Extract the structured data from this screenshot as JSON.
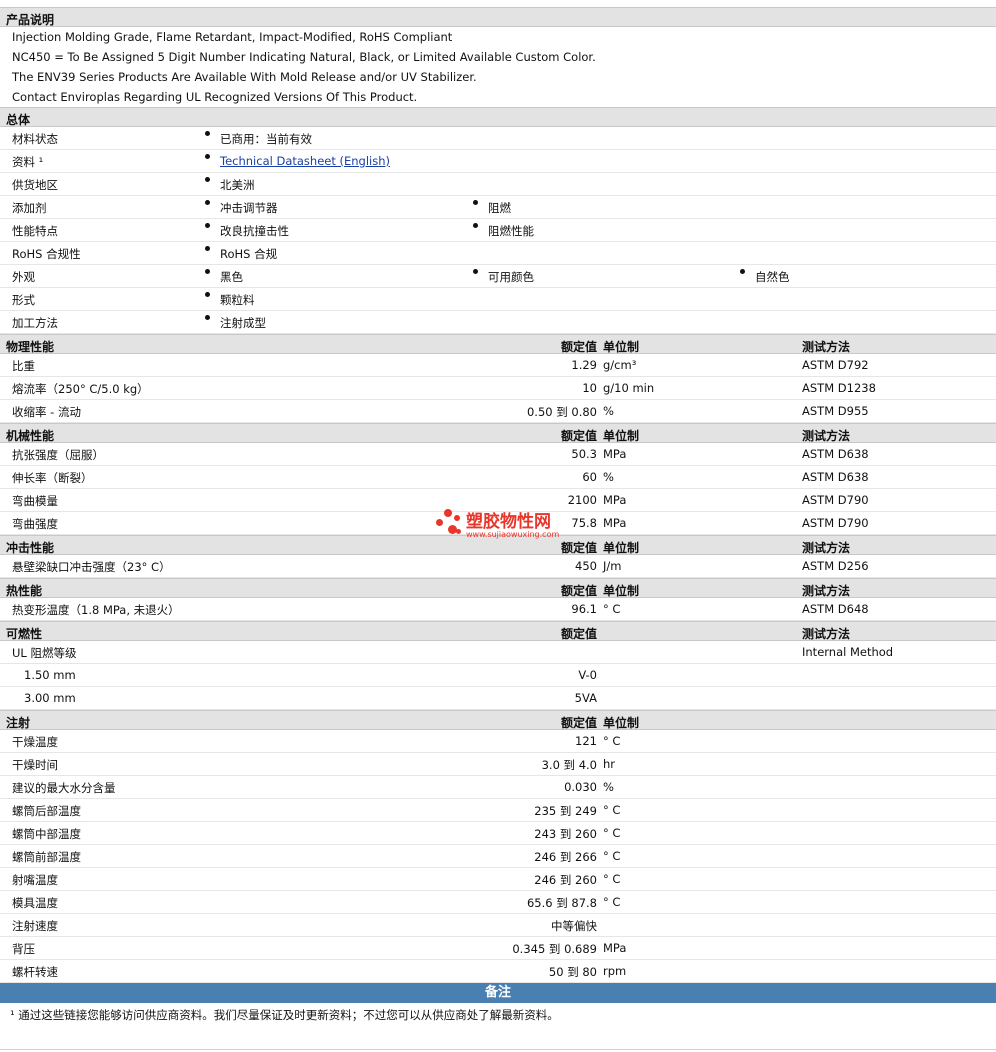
{
  "desc": {
    "title": "产品说明",
    "lines": [
      "Injection Molding Grade, Flame Retardant, Impact-Modified, RoHS Compliant",
      "NC450 = To Be Assigned 5 Digit Number Indicating Natural, Black, or Limited Available Custom Color.",
      "The ENV39 Series Products Are Available With Mold Release and/or UV Stabilizer.",
      "Contact Enviroplas Regarding UL Recognized Versions Of This Product."
    ]
  },
  "general": {
    "title": "总体",
    "rows": [
      {
        "label": "材料状态",
        "items": [
          "已商用：当前有效"
        ]
      },
      {
        "label": "资料 ¹",
        "items": [
          "Technical Datasheet (English)"
        ],
        "link": true
      },
      {
        "label": "供货地区",
        "items": [
          "北美洲"
        ]
      },
      {
        "label": "添加剂",
        "items": [
          "冲击调节器",
          "阻燃"
        ]
      },
      {
        "label": "性能特点",
        "items": [
          "改良抗撞击性",
          "阻燃性能"
        ]
      },
      {
        "label": "RoHS 合规性",
        "items": [
          "RoHS 合规"
        ]
      },
      {
        "label": "外观",
        "items": [
          "黑色",
          "可用颜色",
          "自然色"
        ]
      },
      {
        "label": "形式",
        "items": [
          "颗粒料"
        ]
      },
      {
        "label": "加工方法",
        "items": [
          "注射成型"
        ]
      }
    ]
  },
  "headers": {
    "nominal": "额定值",
    "unit": "单位制",
    "method": "测试方法"
  },
  "physical": {
    "title": "物理性能",
    "rows": [
      {
        "name": "比重",
        "value": "1.29",
        "unit": "g/cm³",
        "method": "ASTM D792"
      },
      {
        "name": "熔流率（250°  C/5.0 kg）",
        "value": "10",
        "unit": "g/10 min",
        "method": "ASTM D1238"
      },
      {
        "name": "收缩率 - 流动",
        "value": "0.50 到  0.80",
        "unit": "%",
        "method": "ASTM D955"
      }
    ]
  },
  "mechanical": {
    "title": "机械性能",
    "rows": [
      {
        "name": "抗张强度（屈服）",
        "value": "50.3",
        "unit": "MPa",
        "method": "ASTM D638"
      },
      {
        "name": "伸长率（断裂）",
        "value": "60",
        "unit": "%",
        "method": "ASTM D638"
      },
      {
        "name": "弯曲模量",
        "value": "2100",
        "unit": "MPa",
        "method": "ASTM D790"
      },
      {
        "name": "弯曲强度",
        "value": "75.8",
        "unit": "MPa",
        "method": "ASTM D790"
      }
    ]
  },
  "impact": {
    "title": "冲击性能",
    "rows": [
      {
        "name": "悬壁梁缺口冲击强度（23°  C）",
        "value": "450",
        "unit": "J/m",
        "method": "ASTM D256"
      }
    ]
  },
  "thermal": {
    "title": "热性能",
    "rows": [
      {
        "name": "热变形温度（1.8 MPa, 未退火）",
        "value": "96.1",
        "unit": "°  C",
        "method": "ASTM D648"
      }
    ]
  },
  "flammability": {
    "title": "可燃性",
    "rows": [
      {
        "name": "UL 阻燃等级",
        "value": "",
        "unit": "",
        "method": "Internal Method"
      },
      {
        "name": "1.50 mm",
        "value": "V-0",
        "unit": "",
        "method": "",
        "indent": true
      },
      {
        "name": "3.00 mm",
        "value": "5VA",
        "unit": "",
        "method": "",
        "indent": true
      }
    ]
  },
  "injection": {
    "title": "注射",
    "rows": [
      {
        "name": "干燥温度",
        "value": "121",
        "unit": "°  C"
      },
      {
        "name": "干燥时间",
        "value": "3.0 到  4.0",
        "unit": "hr"
      },
      {
        "name": "建议的最大水分含量",
        "value": "0.030",
        "unit": "%"
      },
      {
        "name": "螺筒后部温度",
        "value": "235 到  249",
        "unit": "°  C"
      },
      {
        "name": "螺筒中部温度",
        "value": "243 到  260",
        "unit": "°  C"
      },
      {
        "name": "螺筒前部温度",
        "value": "246 到  266",
        "unit": "°  C"
      },
      {
        "name": "射嘴温度",
        "value": "246 到  260",
        "unit": "°  C"
      },
      {
        "name": "模具温度",
        "value": "65.6 到  87.8",
        "unit": "°  C"
      },
      {
        "name": "注射速度",
        "value": "中等偏快",
        "unit": ""
      },
      {
        "name": "背压",
        "value": "0.345 到  0.689",
        "unit": "MPa"
      },
      {
        "name": "螺杆转速",
        "value": "50 到  80",
        "unit": "rpm"
      }
    ]
  },
  "notes": {
    "title": "备注",
    "footnote": "¹ 通过这些链接您能够访问供应商资料。我们尽量保证及时更新资料；不过您可以从供应商处了解最新资料。"
  },
  "watermark": {
    "title": "塑胶物性网",
    "url": "www.sujiaowuxing.com",
    "color": "#e8362b"
  }
}
